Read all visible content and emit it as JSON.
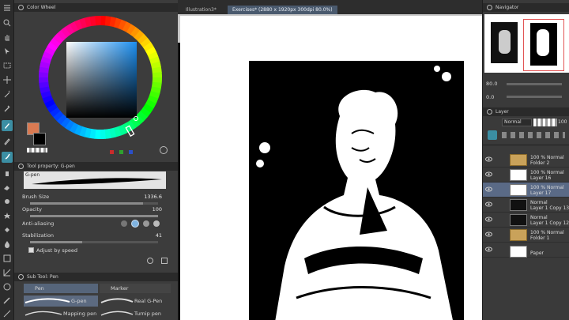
{
  "palettes": {
    "color_wheel_title": "Color Wheel",
    "tool_property_title": "Tool property: G-pen",
    "brush_name": "G-pen",
    "props": [
      {
        "label": "Brush Size",
        "value": "1336.6",
        "fill": 0.88
      },
      {
        "label": "Opacity",
        "value": "100",
        "fill": 1.0
      },
      {
        "label": "Anti-aliasing",
        "value": ""
      },
      {
        "label": "Stabilization",
        "value": "41",
        "fill": 0.41
      }
    ],
    "adjust_by_speed": "Adjust by speed",
    "sub_tool_title": "Sub Tool: Pen",
    "sub_tabs": [
      "Pen",
      "Marker"
    ],
    "brushes": [
      "G-pen",
      "Real G-Pen",
      "Mapping pen",
      "Turnip pen"
    ]
  },
  "tabs": [
    {
      "label": "Illustration3*"
    },
    {
      "label": "Exercises* (2880 x 1920px 300dpi 80.0%)"
    }
  ],
  "navigator": {
    "title": "Navigator",
    "zoom": "80.0",
    "rotation": "0.0"
  },
  "layer_panel": {
    "title": "Layer",
    "blend_mode": "Normal",
    "opacity": "100",
    "layers": [
      {
        "line1": "100 % Normal",
        "line2": "Folder 2",
        "kind": "folder",
        "selected": false
      },
      {
        "line1": "100 % Normal",
        "line2": "Layer 16",
        "kind": "layer",
        "selected": false
      },
      {
        "line1": "100 % Normal",
        "line2": "Layer 17",
        "kind": "layer",
        "selected": true
      },
      {
        "line1": "Normal",
        "line2": "Layer 1 Copy 13",
        "kind": "art",
        "selected": false
      },
      {
        "line1": "Normal",
        "line2": "Layer 1 Copy 12",
        "kind": "art",
        "selected": false
      },
      {
        "line1": "100 % Normal",
        "line2": "Folder 1",
        "kind": "folder",
        "selected": false
      },
      {
        "line1": "",
        "line2": "Paper",
        "kind": "paper",
        "selected": false
      }
    ]
  },
  "colors": {
    "accent": "#3b8ea3",
    "main_color": "#d97a52",
    "sub_color": "#000000",
    "selected_layer": "#5a6a86"
  }
}
